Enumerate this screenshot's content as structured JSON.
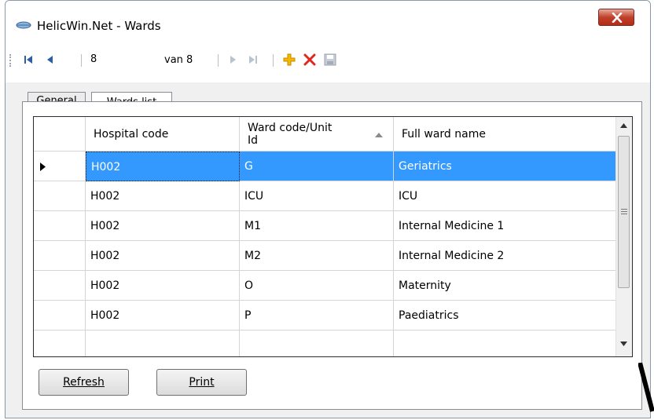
{
  "window": {
    "title": "HelicWin.Net - Wards",
    "close_label": "X"
  },
  "toolbar": {
    "position": "8",
    "of_label": "van 8"
  },
  "tabs": [
    {
      "label": "General",
      "active": false
    },
    {
      "label": "Wards list",
      "active": true
    }
  ],
  "grid": {
    "columns": [
      "Hospital code",
      "Ward code/Unit Id",
      "Full ward name"
    ],
    "sorted_column": "Ward code/Unit Id",
    "selected_row": 0,
    "rows": [
      [
        "H002",
        "G",
        "Geriatrics"
      ],
      [
        "H002",
        "ICU",
        "ICU"
      ],
      [
        "H002",
        "M1",
        "Internal Medicine 1"
      ],
      [
        "H002",
        "M2",
        "Internal Medicine 2"
      ],
      [
        "H002",
        "O",
        "Maternity"
      ],
      [
        "H002",
        "P",
        "Paediatrics"
      ]
    ]
  },
  "buttons": {
    "refresh": "Refresh",
    "print": "Print"
  },
  "icons": [
    "first-record-icon",
    "previous-record-icon",
    "next-record-icon",
    "last-record-icon",
    "add-icon",
    "delete-icon",
    "save-icon",
    "app-icon",
    "close-icon",
    "sort-ascending-icon",
    "row-pointer-icon",
    "scroll-up-icon",
    "scroll-down-icon"
  ],
  "colors": {
    "selection": "#3399ff",
    "close_button": "#c0402b",
    "add_icon": "#f5b800",
    "delete_icon": "#e0281e"
  }
}
